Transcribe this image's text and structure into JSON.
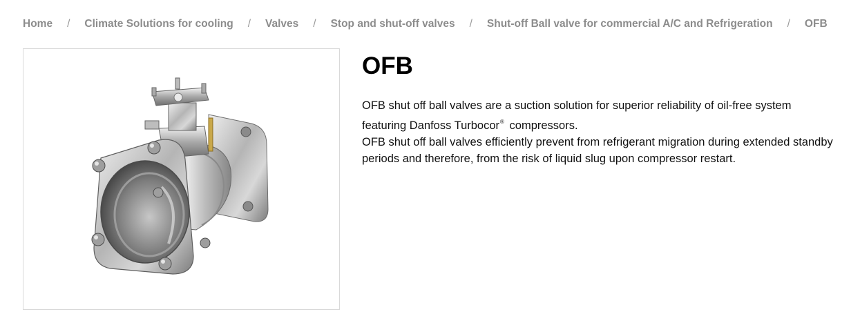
{
  "breadcrumb": {
    "items": [
      "Home",
      "Climate Solutions for cooling",
      "Valves",
      "Stop and shut-off valves",
      "Shut-off Ball valve for commercial A/C and Refrigeration",
      "OFB"
    ],
    "separator": "/"
  },
  "product": {
    "title": "OFB",
    "desc_line1_a": "OFB shut off ball valves are a suction solution for superior reliability of oil-free system featuring Danfoss Turbocor",
    "desc_line1_reg": "®",
    "desc_line1_b": " compressors.",
    "desc_line2": "OFB shut off ball valves efficiently prevent from refrigerant migration during extended standby periods and therefore, from the risk of liquid slug upon compressor restart."
  },
  "colors": {
    "breadcrumb_text": "#8c8c8c",
    "title": "#000000",
    "image_border": "#d9d9d9"
  }
}
